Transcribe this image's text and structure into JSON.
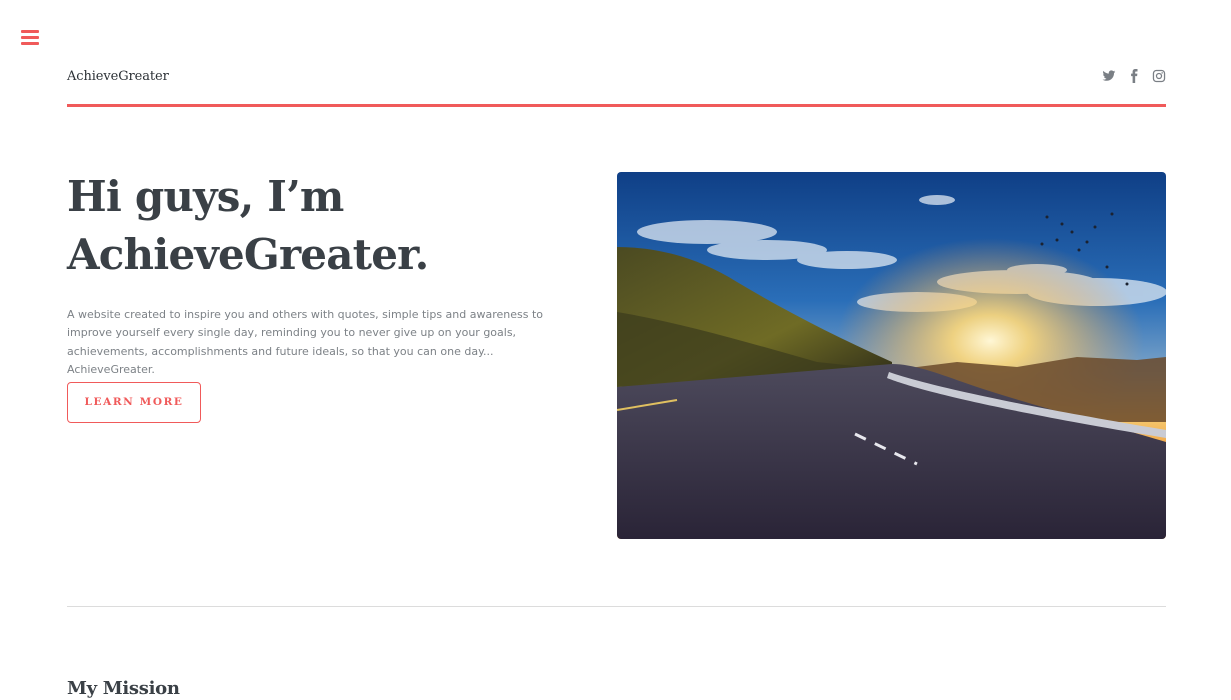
{
  "menu": {
    "icon": "hamburger-menu-icon",
    "color": "#f05a5a"
  },
  "header": {
    "brand": "AchieveGreater",
    "accent_color": "#f05a5a",
    "socials": [
      {
        "name": "twitter",
        "icon": "twitter-icon"
      },
      {
        "name": "facebook",
        "icon": "facebook-icon"
      },
      {
        "name": "instagram",
        "icon": "instagram-icon"
      }
    ]
  },
  "hero": {
    "title_line1": "Hi guys, I’m",
    "title_line2": "AchieveGreater.",
    "description": "A website created to inspire you and others with quotes, simple tips and awareness to improve yourself every single day, reminding you to never give up on your goals, achievements, accomplishments and future ideals, so that you can one day... AchieveGreater.",
    "button_label": "LEARN MORE",
    "image": "road-sunset-landscape-photo"
  },
  "mission": {
    "title": "My Mission"
  }
}
